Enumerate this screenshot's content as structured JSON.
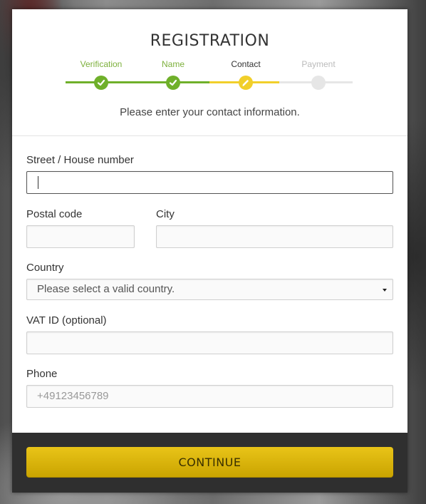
{
  "title": "REGISTRATION",
  "steps": [
    {
      "label": "Verification",
      "state": "done",
      "color": "#7db03c"
    },
    {
      "label": "Name",
      "state": "done",
      "color": "#7db03c"
    },
    {
      "label": "Contact",
      "state": "active",
      "color": "#333333"
    },
    {
      "label": "Payment",
      "state": "pending",
      "color": "#bbbbbb"
    }
  ],
  "colors": {
    "done": "#6fb02a",
    "active": "#f1cf2a",
    "pending": "#e6e6e6",
    "accent": "#e2bc12"
  },
  "subtitle": "Please enter your contact information.",
  "form": {
    "street_label": "Street / House number",
    "street_value": "",
    "postal_label": "Postal code",
    "postal_value": "",
    "city_label": "City",
    "city_value": "",
    "country_label": "Country",
    "country_selected": "Please select a valid country.",
    "vat_label": "VAT ID (optional)",
    "vat_value": "",
    "phone_label": "Phone",
    "phone_placeholder": "+49123456789"
  },
  "continue_label": "CONTINUE",
  "icons": {
    "done": "check-icon",
    "active": "pencil-icon"
  }
}
